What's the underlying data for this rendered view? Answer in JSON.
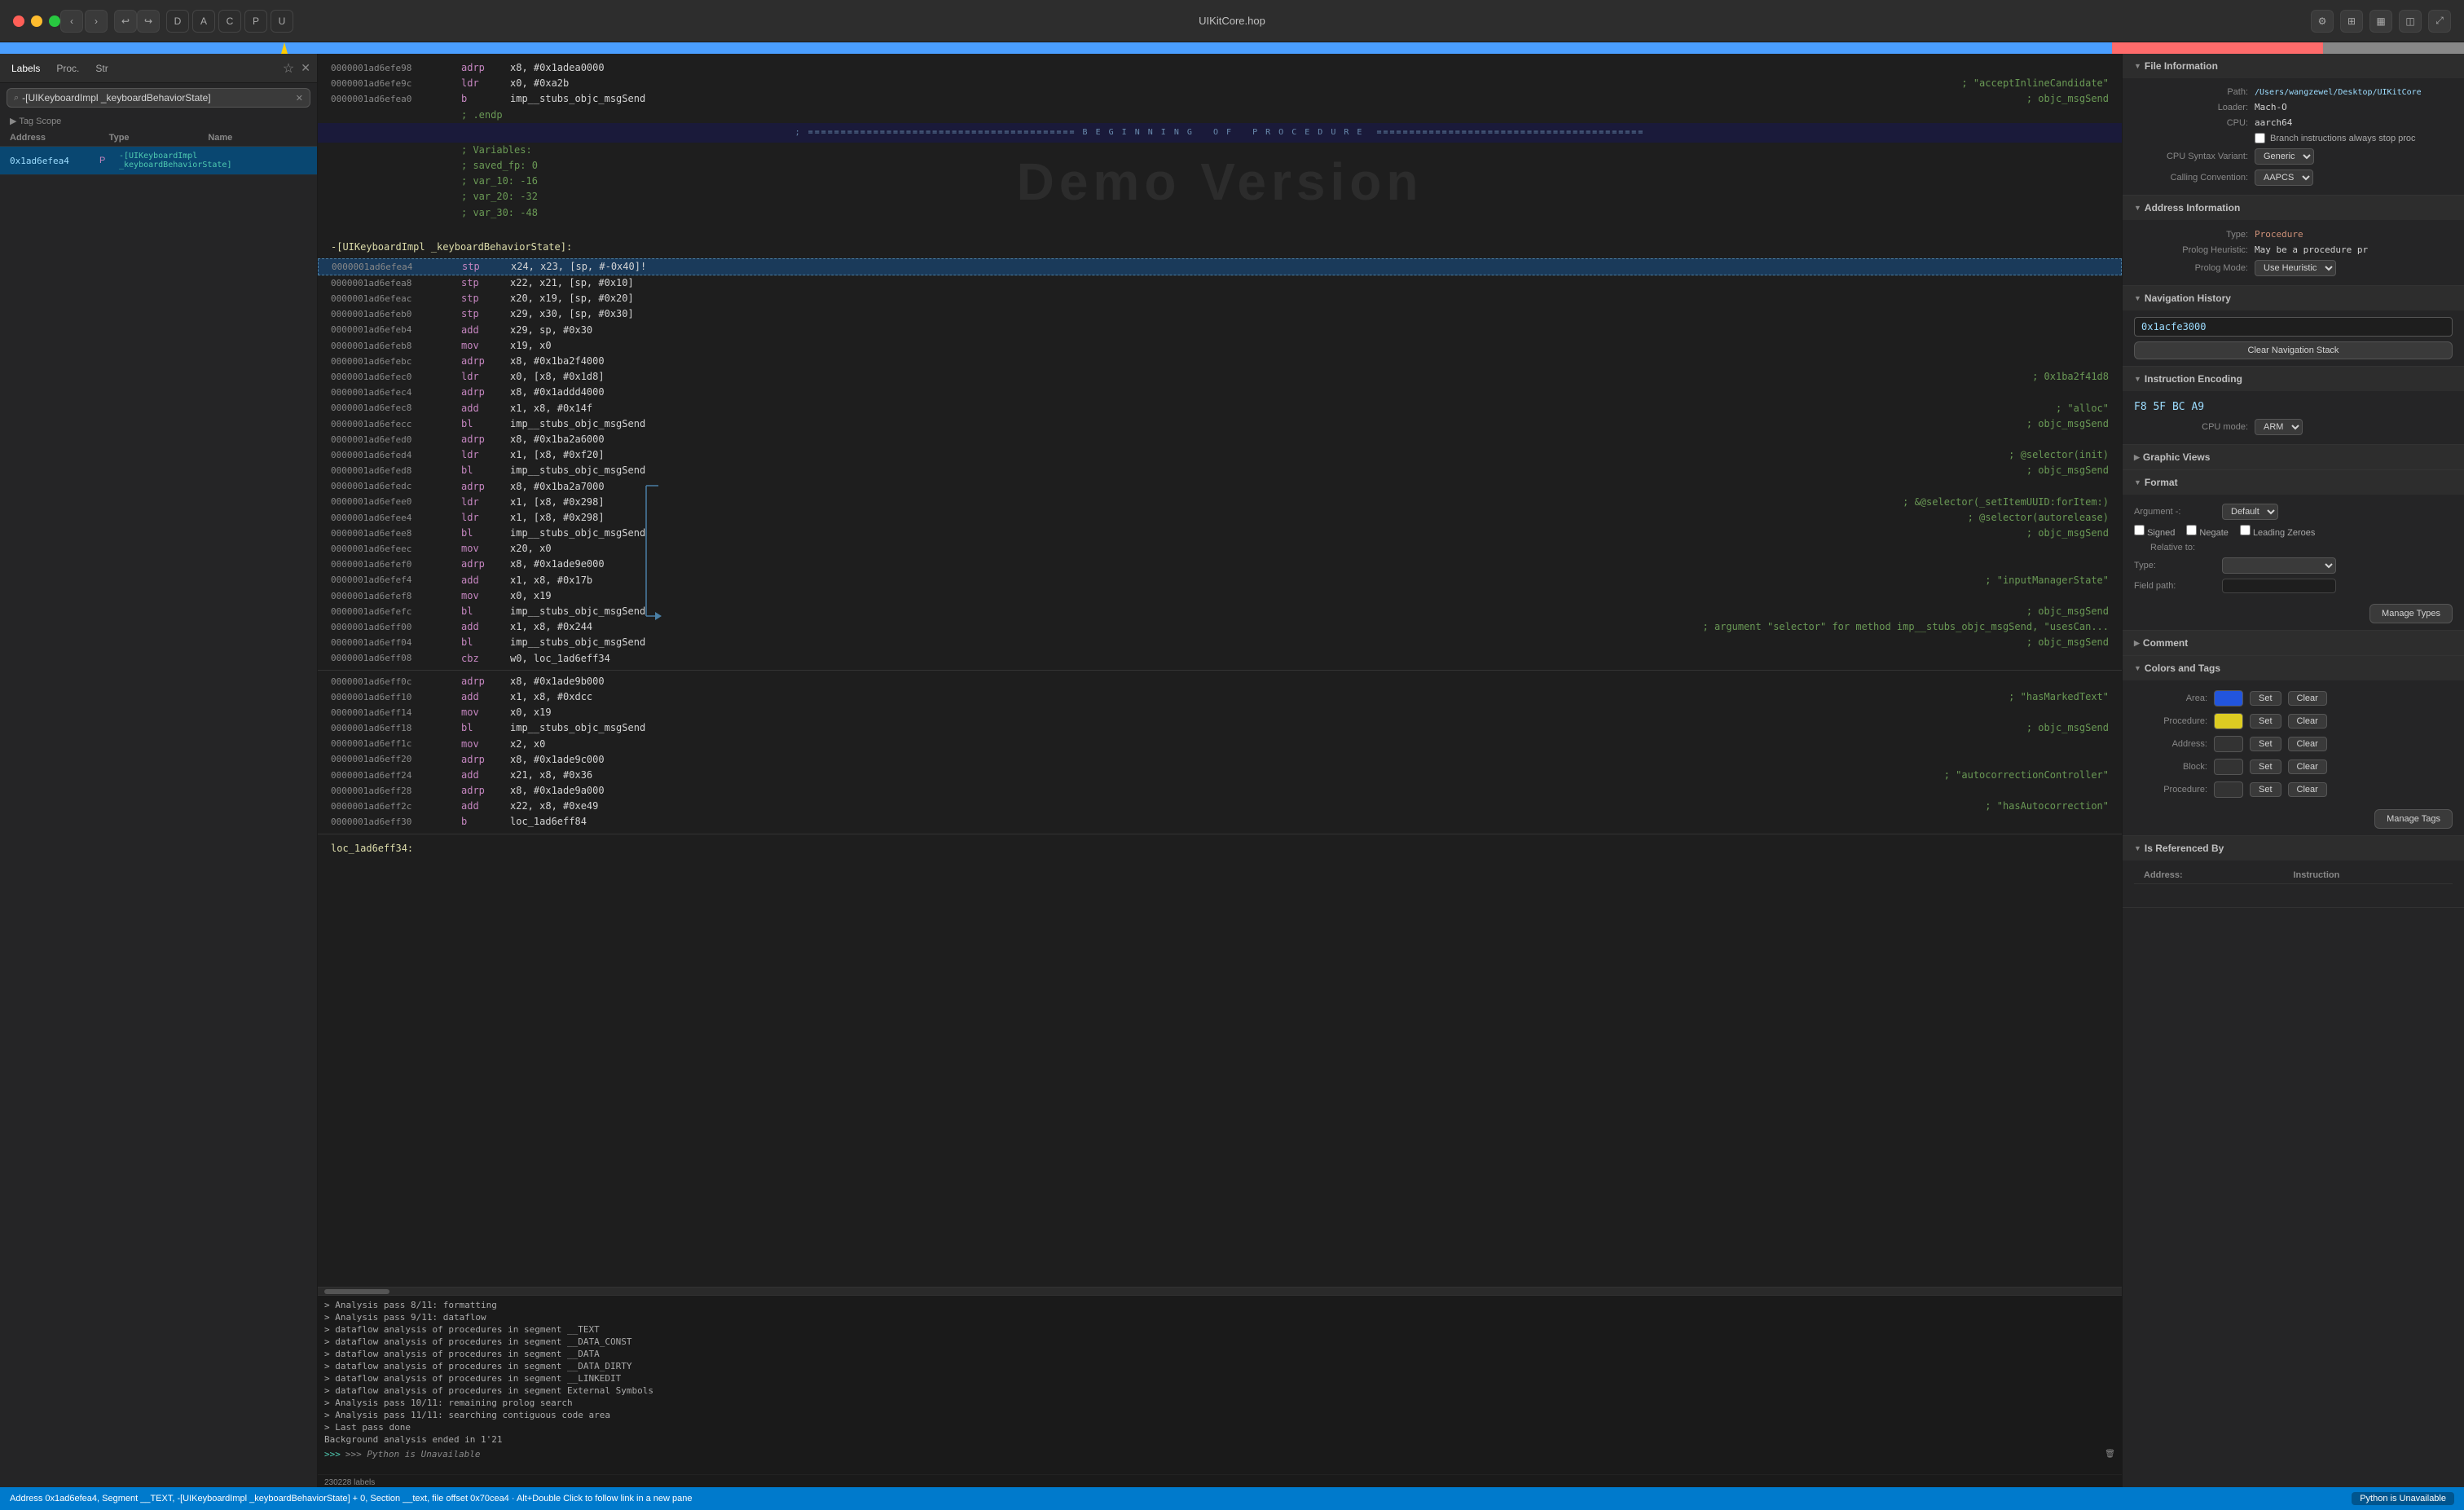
{
  "titlebar": {
    "app_name": "UIKitCore.hop",
    "traffic_lights": [
      "red",
      "yellow",
      "green"
    ],
    "nav_prev": "‹",
    "nav_next": "›",
    "letters": [
      "D",
      "A",
      "C",
      "P",
      "U"
    ]
  },
  "left_panel": {
    "tabs": [
      {
        "id": "labels",
        "label": "Labels",
        "active": true
      },
      {
        "id": "proc",
        "label": "Proc."
      },
      {
        "id": "str",
        "label": "Str"
      }
    ],
    "search_placeholder": "-[UIKeyboardImpl _keyboardBehaviorState]",
    "tag_scope": "▶ Tag Scope",
    "list_headers": [
      "Address",
      "Type",
      "Name"
    ],
    "list_items": [
      {
        "address": "0x1ad6efea4",
        "type": "P",
        "name": "-[UIKeyboardImpl _keyboardBehaviorState]"
      }
    ],
    "label_count": "230228 labels"
  },
  "code_area": {
    "lines": [
      {
        "id": "l1",
        "addr": "0000001ad6efe98",
        "mnem": "adrp",
        "ops": "x8, #0x1adea0000"
      },
      {
        "id": "l2",
        "addr": "0000001ad6efe9c",
        "mnem": "ldr",
        "ops": "x0, #0xa2b"
      },
      {
        "id": "l3",
        "addr": "0000001ad6efea0",
        "mnem": "b",
        "ops": "imp__stubs_objc_msgSend",
        "comment": "; objc_msgSend"
      },
      {
        "id": "l4",
        "type": "comment",
        "text": "; .endp"
      },
      {
        "id": "l5",
        "type": "section_header",
        "text": "; ========================================= B E G I N N I N G   O F   P R O C E D U R E ========================================="
      },
      {
        "id": "l6",
        "type": "comment",
        "text": "; Variables:"
      },
      {
        "id": "l7",
        "type": "comment",
        "text": ";   saved_fp: 0"
      },
      {
        "id": "l8",
        "type": "comment",
        "text": ";   var_10: -16"
      },
      {
        "id": "l9",
        "type": "comment",
        "text": ";   var_20: -32"
      },
      {
        "id": "l10",
        "type": "comment",
        "text": ";   var_30: -48"
      },
      {
        "id": "l11",
        "type": "label",
        "text": "-[UIKeyboardImpl _keyboardBehaviorState]:"
      },
      {
        "id": "l12",
        "addr": "0000001ad6efea4",
        "mnem": "stp",
        "ops": "x24, x23, [sp, #-0x40]!"
      },
      {
        "id": "l13",
        "addr": "0000001ad6efea8",
        "mnem": "stp",
        "ops": "x22, x21, [sp, #0x10]"
      },
      {
        "id": "l14",
        "addr": "0000001ad6efeac",
        "mnem": "stp",
        "ops": "x20, x19, [sp, #0x20]"
      },
      {
        "id": "l15",
        "addr": "0000001ad6efeb0",
        "mnem": "stp",
        "ops": "x29, x30, [sp, #0x30]"
      },
      {
        "id": "l16",
        "addr": "0000001ad6efeb4",
        "mnem": "add",
        "ops": "x29, sp, #0x30"
      },
      {
        "id": "l17",
        "addr": "0000001ad6efeb8",
        "mnem": "mov",
        "ops": "x19, x0"
      },
      {
        "id": "l18",
        "addr": "0000001ad6efebc",
        "mnem": "adrp",
        "ops": "x8, #0x1ba2f4000"
      },
      {
        "id": "l19",
        "addr": "0000001ad6efec0",
        "mnem": "ldr",
        "ops": "x0, [x8, #0x1d8]",
        "comment": "; 0x1ba2f41d8"
      },
      {
        "id": "l20",
        "addr": "0000001ad6efec4",
        "mnem": "adrp",
        "ops": "x8, #0x1addd4000"
      },
      {
        "id": "l21",
        "addr": "0000001ad6efec8",
        "mnem": "add",
        "ops": "x1, x8, #0x14f",
        "comment": "; \"alloc\""
      },
      {
        "id": "l22",
        "addr": "0000001ad6efecc",
        "mnem": "bl",
        "ops": "imp__stubs_objc_msgSend",
        "comment": "; objc_msgSend"
      },
      {
        "id": "l23",
        "addr": "0000001ad6efed0",
        "mnem": "adrp",
        "ops": "x8, #0x1ba2a6000"
      },
      {
        "id": "l24",
        "addr": "0000001ad6efed4",
        "mnem": "ldr",
        "ops": "x1, [x8, #0xf20]",
        "comment": "; @selector(init)"
      },
      {
        "id": "l25",
        "addr": "0000001ad6efed8",
        "mnem": "bl",
        "ops": "imp__stubs_objc_msgSend",
        "comment": "; objc_msgSend"
      },
      {
        "id": "l26",
        "addr": "0000001ad6efedc",
        "mnem": "adrp",
        "ops": "x8, #0x1ba2a7000"
      },
      {
        "id": "l27",
        "addr": "0000001ad6efee0",
        "mnem": "ldr",
        "ops": "x1, [x8, #0x298]",
        "comment": "; &@selector(_setItemUUID:forItem:)"
      },
      {
        "id": "l28",
        "addr": "0000001ad6efee4",
        "mnem": "ldr",
        "ops": "x1, [x8, #0x298]",
        "comment": "; @selector(autorelease)"
      },
      {
        "id": "l29",
        "addr": "0000001ad6efee8",
        "mnem": "bl",
        "ops": "imp__stubs_objc_msgSend",
        "comment": "; objc_msgSend"
      },
      {
        "id": "l30",
        "addr": "0000001ad6efeec",
        "mnem": "mov",
        "ops": "x20, x0"
      },
      {
        "id": "l31",
        "addr": "0000001ad6efef0",
        "mnem": "adrp",
        "ops": "x8, #0x1ade9e000"
      },
      {
        "id": "l32",
        "addr": "0000001ad6efef4",
        "mnem": "add",
        "ops": "x1, x8, #0x17b",
        "comment": "; \"inputManagerState\""
      },
      {
        "id": "l33",
        "addr": "0000001ad6efef8",
        "mnem": "mov",
        "ops": "x0, x19"
      },
      {
        "id": "l34",
        "addr": "0000001ad6efefc",
        "mnem": "bl",
        "ops": "imp__stubs_objc_msgSend",
        "comment": "; objc_msgSend"
      },
      {
        "id": "l35",
        "addr": "0000001ad6eff00",
        "mnem": "add",
        "ops": "x1, x8, #0x244",
        "comment": "; argument \"selector\" for method imp__stubs_objc_msgSend, \"usesCan..."
      },
      {
        "id": "l36",
        "addr": "0000001ad6eff04",
        "mnem": "bl",
        "ops": "imp__stubs_objc_msgSend",
        "comment": "; objc_msgSend"
      },
      {
        "id": "l37",
        "addr": "0000001ad6eff08",
        "mnem": "cbz",
        "ops": "w0, loc_1ad6eff34"
      },
      {
        "id": "l38",
        "addr": "0000001ad6eff0c",
        "mnem": "adrp",
        "ops": "x8, #0x1ade9b000"
      },
      {
        "id": "l39",
        "addr": "0000001ad6eff10",
        "mnem": "add",
        "ops": "x1, x8, #0xdcc",
        "comment": "; \"hasMarkedText\""
      },
      {
        "id": "l40",
        "addr": "0000001ad6eff14",
        "mnem": "mov",
        "ops": "x0, x19"
      },
      {
        "id": "l41",
        "addr": "0000001ad6eff18",
        "mnem": "bl",
        "ops": "imp__stubs_objc_msgSend",
        "comment": "; objc_msgSend"
      },
      {
        "id": "l42",
        "addr": "0000001ad6eff1c",
        "mnem": "mov",
        "ops": "x2, x0"
      },
      {
        "id": "l43",
        "addr": "0000001ad6eff20",
        "mnem": "adrp",
        "ops": "x8, #0x1ade9c000"
      },
      {
        "id": "l44",
        "addr": "0000001ad6eff24",
        "mnem": "add",
        "ops": "x21, x8, #0x36",
        "comment": "; \"autocorrectionController\""
      },
      {
        "id": "l45",
        "addr": "0000001ad6eff28",
        "mnem": "adrp",
        "ops": "x8, #0x1ade9a000"
      },
      {
        "id": "l46",
        "addr": "0000001ad6eff2c",
        "mnem": "add",
        "ops": "x22, x8, #0xe49"
      },
      {
        "id": "l47",
        "addr": "0000001ad6eff30",
        "mnem": "b",
        "ops": "loc_1ad6eff84"
      },
      {
        "id": "l48",
        "type": "label",
        "text": "loc_1ad6eff34:"
      }
    ]
  },
  "log_panel": {
    "lines": [
      "> Analysis pass 8/11: formatting",
      "> Analysis pass 9/11: dataflow",
      "> dataflow analysis of procedures in segment __TEXT",
      "> dataflow analysis of procedures in segment __DATA_CONST",
      "> dataflow analysis of procedures in segment __DATA",
      "> dataflow analysis of procedures in segment __DATA_DIRTY",
      "> dataflow analysis of procedures in segment __LINKEDIT",
      "> dataflow analysis of procedures in segment External Symbols",
      "> Analysis pass 10/11: remaining prolog search",
      "> Analysis pass 11/11: searching contiguous code area",
      "> Last pass done",
      "Background analysis ended in 1'21",
      ">>> Python is Unavailable"
    ]
  },
  "right_panel": {
    "file_info": {
      "title": "File Information",
      "path_label": "Path:",
      "path_value": "/Users/wangzewel/Desktop/UIKitCore",
      "loader_label": "Loader:",
      "loader_value": "Mach-O",
      "cpu_label": "CPU:",
      "cpu_value": "aarch64",
      "branch_checkbox": "Branch instructions always stop proc",
      "cpu_syntax_label": "CPU Syntax Variant:",
      "cpu_syntax_value": "Generic",
      "calling_conv_label": "Calling Convention:",
      "calling_conv_value": "AAPCS"
    },
    "address_info": {
      "title": "Address Information",
      "type_label": "Type:",
      "type_value": "Procedure",
      "prolog_heur_label": "Prolog Heuristic:",
      "prolog_heur_value": "May be a procedure pr",
      "prolog_mode_label": "Prolog Mode:",
      "prolog_mode_value": "Use Heuristic"
    },
    "nav_history": {
      "title": "Navigation History",
      "value": "0x1acfe3000",
      "clear_btn": "Clear Navigation Stack"
    },
    "instruction_encoding": {
      "title": "Instruction Encoding",
      "hex_value": "F8 5F BC A9",
      "cpu_mode_label": "CPU mode:",
      "cpu_mode_value": "ARM"
    },
    "graphic_views": {
      "title": "Graphic Views"
    },
    "format": {
      "title": "Format",
      "argument_label": "Argument -:",
      "argument_value": "Default",
      "signed_label": "Signed",
      "negate_label": "Negate",
      "leading_zeroes_label": "Leading Zeroes",
      "relative_to_label": "Relative to:",
      "type_label": "Type:",
      "field_path_label": "Field path:",
      "manage_types_btn": "Manage Types"
    },
    "comment": {
      "title": "Comment"
    },
    "colors_tags": {
      "title": "Colors and Tags",
      "area_label": "Area:",
      "area_color": "#2255dd",
      "procedure_label": "Procedure:",
      "procedure_color": "#ddcc22",
      "address_label": "Address:",
      "block_label": "Block:",
      "procedure2_label": "Procedure:",
      "set_btn": "Set",
      "clear_btn": "Clear",
      "manage_tags_btn": "Manage Tags"
    },
    "is_ref": {
      "title": "Is Referenced By",
      "address_label": "Address:",
      "instruction_label": "Instruction"
    }
  },
  "status_bar": {
    "address_text": "Address 0x1ad6efea4, Segment __TEXT, -[UIKeyboardImpl _keyboardBehaviorState] + 0, Section __text, file offset 0x70cea4 · Alt+Double Click to follow link in a new pane",
    "python_status": "Python is Unavailable",
    "label_count": "230228 labels"
  }
}
